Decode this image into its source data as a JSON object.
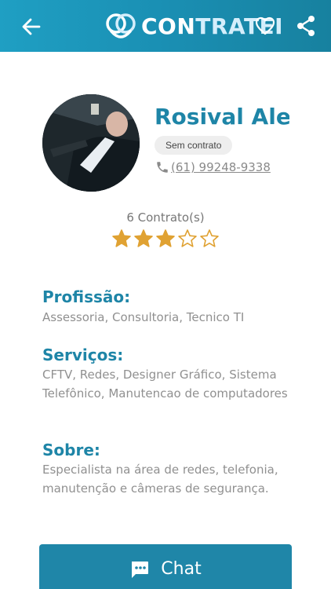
{
  "header": {
    "logo_part1": "CON",
    "logo_part2": "TRATEI",
    "icons": [
      "arrow-left-icon",
      "logo-icon",
      "heart-icon",
      "share-icon"
    ],
    "background_color": "#1f9fc3"
  },
  "profile": {
    "name": "Rosival Alek",
    "status_badge": "Sem contrato",
    "phone": "(61) 99248-9338",
    "contracts_label": "6 Contrato(s)",
    "rating": 3,
    "rating_max": 5,
    "star_color": "#e0a233"
  },
  "sections": {
    "profession_title": "Profissão:",
    "profession_text": "Assessoria, Consultoria, Tecnico TI",
    "services_title": "Serviços:",
    "services_text": "CFTV, Redes, Designer Gráfico, Sistema Telefônico, Manutencao de computadores",
    "about_title": "Sobre:",
    "about_text": "Especialista na área de redes, telefonia, manutenção e câmeras de segurança."
  },
  "actions": {
    "chat_label": "Chat",
    "accent_color": "#1f86a8"
  }
}
